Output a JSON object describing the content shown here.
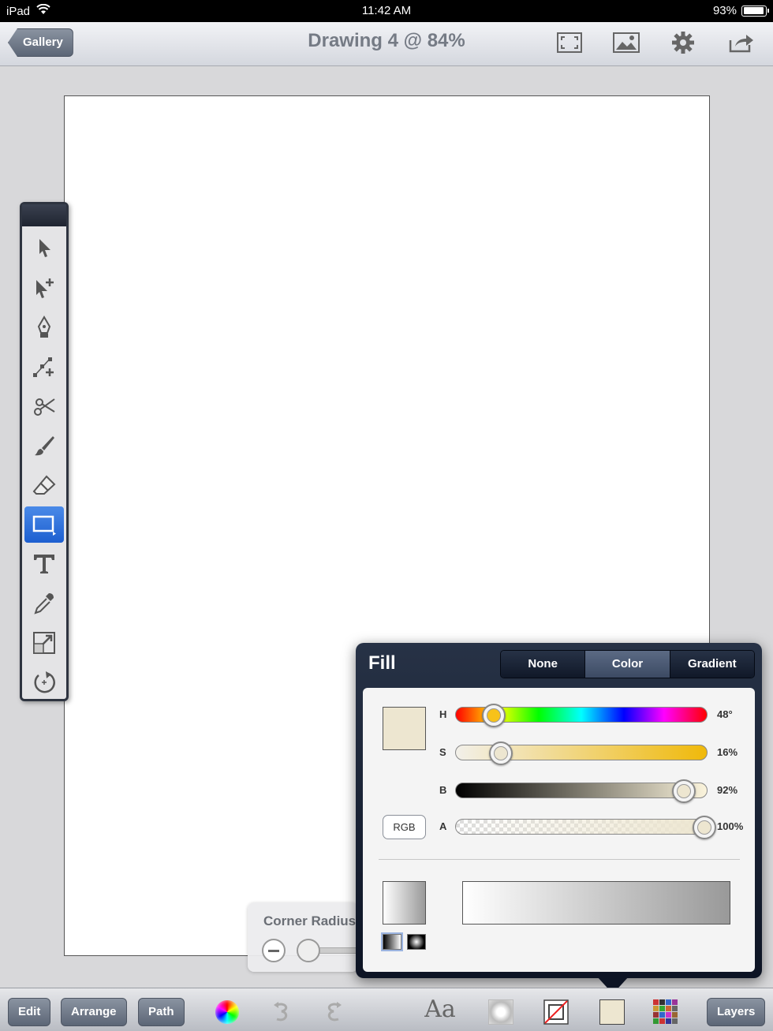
{
  "status_bar": {
    "device": "iPad",
    "time": "11:42 AM",
    "battery": "93%",
    "battery_level": 0.93
  },
  "nav": {
    "back_label": "Gallery",
    "title": "Drawing 4 @ 84%",
    "icons": [
      "fullscreen-icon",
      "image-icon",
      "gear-icon",
      "share-icon"
    ]
  },
  "tools": [
    {
      "name": "select-arrow-icon"
    },
    {
      "name": "subselect-arrow-icon"
    },
    {
      "name": "pen-nib-icon"
    },
    {
      "name": "add-anchor-icon"
    },
    {
      "name": "scissors-icon"
    },
    {
      "name": "brush-icon"
    },
    {
      "name": "eraser-icon"
    },
    {
      "name": "rectangle-shape-icon",
      "active": true
    },
    {
      "name": "text-tool-icon"
    },
    {
      "name": "eyedropper-icon"
    },
    {
      "name": "scale-icon"
    },
    {
      "name": "rotate-icon"
    }
  ],
  "fill_panel": {
    "title": "Fill",
    "tabs": [
      {
        "label": "None",
        "selected": false
      },
      {
        "label": "Color",
        "selected": true
      },
      {
        "label": "Gradient",
        "selected": false
      }
    ],
    "swatch_color": "#ede6d0",
    "mode_button": "RGB",
    "sliders": [
      {
        "letter": "H",
        "value": "48°",
        "position": 0.15
      },
      {
        "letter": "S",
        "value": "16%",
        "position": 0.18
      },
      {
        "letter": "B",
        "value": "92%",
        "position": 0.91
      },
      {
        "letter": "A",
        "value": "100%",
        "position": 0.99
      }
    ]
  },
  "corner_radius": {
    "label": "Corner Radius"
  },
  "toolbar": {
    "edit": "Edit",
    "arrange": "Arrange",
    "path": "Path",
    "font_glyph": "Aa",
    "layers": "Layers"
  }
}
